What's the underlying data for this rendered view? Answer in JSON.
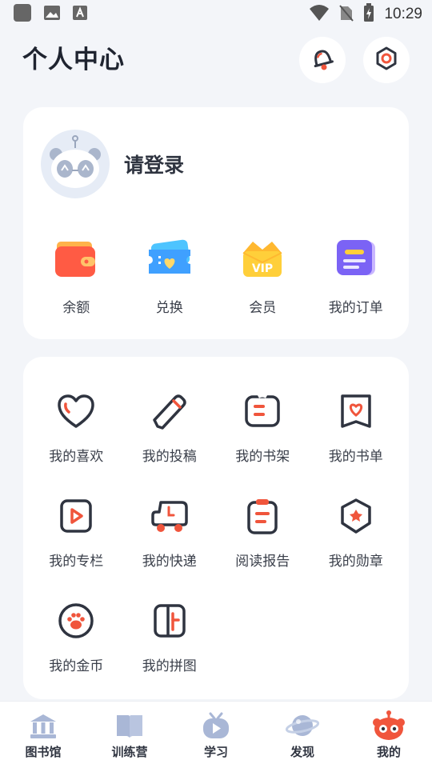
{
  "status_bar": {
    "time": "10:29"
  },
  "header": {
    "title": "个人中心"
  },
  "profile": {
    "login_text": "请登录"
  },
  "quick_actions": [
    {
      "label": "余额",
      "icon": "wallet-icon"
    },
    {
      "label": "兑换",
      "icon": "ticket-icon"
    },
    {
      "label": "会员",
      "icon": "vip-crown-icon"
    },
    {
      "label": "我的订单",
      "icon": "order-icon"
    }
  ],
  "features": [
    {
      "label": "我的喜欢",
      "icon": "heart-icon"
    },
    {
      "label": "我的投稿",
      "icon": "pencil-icon"
    },
    {
      "label": "我的书架",
      "icon": "bookshelf-icon"
    },
    {
      "label": "我的书单",
      "icon": "booklist-icon"
    },
    {
      "label": "我的专栏",
      "icon": "column-play-icon"
    },
    {
      "label": "我的快递",
      "icon": "delivery-truck-icon"
    },
    {
      "label": "阅读报告",
      "icon": "report-clipboard-icon"
    },
    {
      "label": "我的勋章",
      "icon": "medal-icon"
    },
    {
      "label": "我的金币",
      "icon": "coin-paw-icon"
    },
    {
      "label": "我的拼图",
      "icon": "puzzle-icon"
    }
  ],
  "bottom_nav": [
    {
      "label": "图书馆",
      "icon": "library-icon"
    },
    {
      "label": "训练营",
      "icon": "training-book-icon"
    },
    {
      "label": "学习",
      "icon": "study-tv-icon"
    },
    {
      "label": "发现",
      "icon": "discover-planet-icon"
    },
    {
      "label": "我的",
      "icon": "me-robot-icon",
      "active": true
    }
  ],
  "colors": {
    "accent": "#f0553c",
    "text_dark": "#2f3440",
    "background": "#f3f5f9"
  }
}
